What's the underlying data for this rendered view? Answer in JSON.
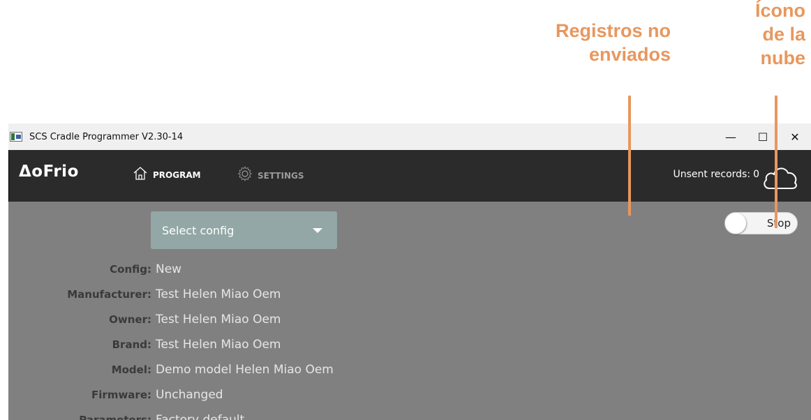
{
  "annotations": {
    "unsent_records": "Registros no enviados",
    "cloud_icon": "Ícono de la nube"
  },
  "window": {
    "title": "SCS Cradle Programmer V2.30-14",
    "controls": {
      "minimize": "—",
      "maximize": "☐",
      "close": "✕"
    }
  },
  "navbar": {
    "logo": "ΔoFrio",
    "items": [
      {
        "label": "PROGRAM",
        "icon": "home-icon",
        "active": true
      },
      {
        "label": "SETTINGS",
        "icon": "gear-icon",
        "active": false
      }
    ],
    "unsent_label": "Unsent records:",
    "unsent_count": "0",
    "cloud_icon": "cloud-icon"
  },
  "main": {
    "select_config": "Select config",
    "toggle_label": "Stop",
    "details": [
      {
        "key": "Config:",
        "value": "New"
      },
      {
        "key": "Manufacturer:",
        "value": "Test Helen Miao Oem"
      },
      {
        "key": "Owner:",
        "value": "Test Helen Miao Oem"
      },
      {
        "key": "Brand:",
        "value": "Test Helen Miao Oem"
      },
      {
        "key": "Model:",
        "value": "Demo model Helen Miao Oem"
      },
      {
        "key": "Firmware:",
        "value": "Unchanged"
      },
      {
        "key": "Parameters:",
        "value": "Factory default"
      }
    ]
  },
  "colors": {
    "annotation": "#e8975e",
    "navbar": "#2b2b2b",
    "content": "#808080",
    "select": "#93a8a6"
  }
}
